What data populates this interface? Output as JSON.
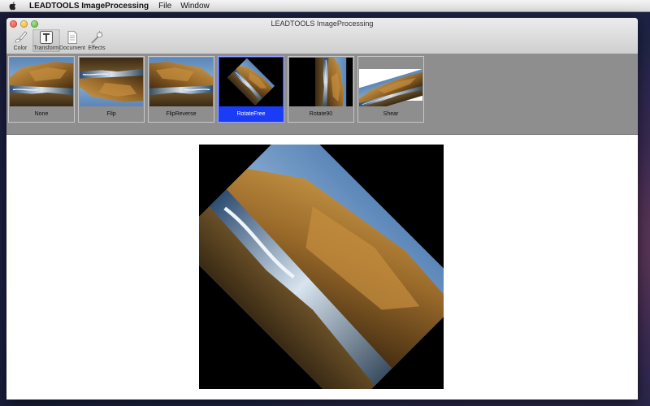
{
  "menubar": {
    "app_name": "LEADTOOLS ImageProcessing",
    "items": [
      "File",
      "Window"
    ]
  },
  "window": {
    "title": "LEADTOOLS ImageProcessing"
  },
  "toolbar": {
    "items": [
      {
        "label": "Color",
        "icon": "brush-icon"
      },
      {
        "label": "Transform",
        "icon": "transform-icon",
        "active": true
      },
      {
        "label": "Document",
        "icon": "document-icon"
      },
      {
        "label": "Effects",
        "icon": "effects-icon"
      }
    ]
  },
  "thumbnails": [
    {
      "label": "None"
    },
    {
      "label": "Flip"
    },
    {
      "label": "FlipReverse"
    },
    {
      "label": "RotateFree",
      "selected": true
    },
    {
      "label": "Rotate90"
    },
    {
      "label": "Shear"
    }
  ],
  "colors": {
    "selected_thumb": "#1b3cf7",
    "strip_background": "#8e8e8e",
    "preview_background": "#000000"
  }
}
